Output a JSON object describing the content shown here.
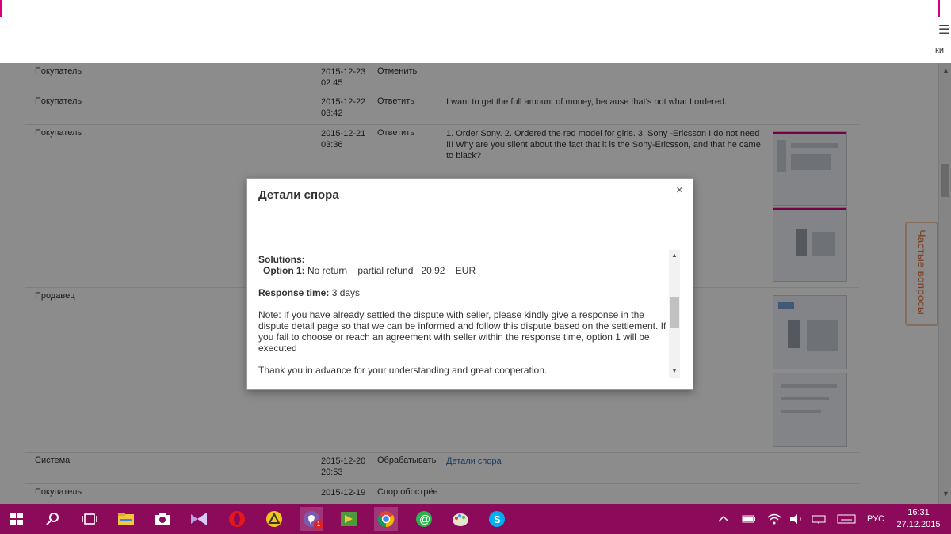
{
  "header": {
    "menu_tail": "ки"
  },
  "rows": [
    {
      "role": "Покупатель",
      "date": "2015-12-23",
      "time": "02:45",
      "action": "Отменить",
      "message": ""
    },
    {
      "role": "Покупатель",
      "date": "2015-12-22",
      "time": "03:42",
      "action": "Ответить",
      "message": "I want to get the full amount of money, because that's not what I ordered."
    },
    {
      "role": "Покупатель",
      "date": "2015-12-21",
      "time": "03:36",
      "action": "Ответить",
      "message": "1. Order Sony. 2. Ordered the red model for girls. 3. Sony -Ericsson I do not need !!! Why are you silent about the fact that it is the Sony-Ericsson, and that he came to black?"
    },
    {
      "role": "Продавец",
      "date": "",
      "time": "",
      "action": "",
      "message": ""
    },
    {
      "role": "Система",
      "date": "2015-12-20",
      "time": "20:53",
      "action": "Обрабатывать",
      "link": "Детали спора"
    },
    {
      "role": "Покупатель",
      "date": "2015-12-19",
      "time": "",
      "action": "Спор обострён",
      "message": ""
    }
  ],
  "faq_label": "Частые вопросы",
  "modal": {
    "title": "Детали спора",
    "close": "×",
    "solutions_label": "Solutions:",
    "option_label": "Option 1:",
    "option_text": " No return    partial refund   20.92    EUR",
    "response_label": "Response time:",
    "response_value": " 3 days",
    "note": "Note: If you have already settled the dispute with seller, please kindly give a response in the dispute detail page so that we can be informed and follow this dispute based on the settlement. If you fail to choose or reach an agreement with seller within the response time, option 1 will be executed",
    "thanks": "Thank you in advance for your understanding and great cooperation."
  },
  "taskbar": {
    "lang": "РУС",
    "time": "16:31",
    "date": "27.12.2015",
    "viber_badge": "1"
  }
}
